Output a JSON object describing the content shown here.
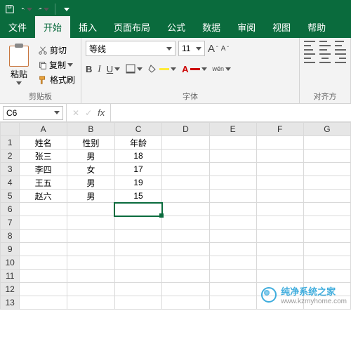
{
  "titlebar": {
    "icons": [
      "save-icon",
      "undo-icon",
      "redo-icon"
    ]
  },
  "tabs": {
    "items": [
      "文件",
      "开始",
      "插入",
      "页面布局",
      "公式",
      "数据",
      "审阅",
      "视图",
      "帮助"
    ],
    "active_index": 1
  },
  "ribbon": {
    "clipboard": {
      "paste": "粘贴",
      "cut": "剪切",
      "copy": "复制",
      "format_painter": "格式刷",
      "group_label": "剪贴板"
    },
    "font": {
      "name": "等线",
      "size": "11",
      "bold": "B",
      "italic": "I",
      "underline": "U",
      "ruby": "wén",
      "group_label": "字体"
    },
    "alignment": {
      "group_label": "对齐方"
    }
  },
  "namebox": {
    "ref": "C6"
  },
  "columns": [
    "A",
    "B",
    "C",
    "D",
    "E",
    "F",
    "G"
  ],
  "rows": [
    {
      "n": "1",
      "cells": [
        "姓名",
        "性别",
        "年龄",
        "",
        "",
        "",
        ""
      ]
    },
    {
      "n": "2",
      "cells": [
        "张三",
        "男",
        "18",
        "",
        "",
        "",
        ""
      ]
    },
    {
      "n": "3",
      "cells": [
        "李四",
        "女",
        "17",
        "",
        "",
        "",
        ""
      ]
    },
    {
      "n": "4",
      "cells": [
        "王五",
        "男",
        "19",
        "",
        "",
        "",
        ""
      ]
    },
    {
      "n": "5",
      "cells": [
        "赵六",
        "男",
        "15",
        "",
        "",
        "",
        ""
      ]
    },
    {
      "n": "6",
      "cells": [
        "",
        "",
        "",
        "",
        "",
        "",
        ""
      ]
    },
    {
      "n": "7",
      "cells": [
        "",
        "",
        "",
        "",
        "",
        "",
        ""
      ]
    },
    {
      "n": "8",
      "cells": [
        "",
        "",
        "",
        "",
        "",
        "",
        ""
      ]
    },
    {
      "n": "9",
      "cells": [
        "",
        "",
        "",
        "",
        "",
        "",
        ""
      ]
    },
    {
      "n": "10",
      "cells": [
        "",
        "",
        "",
        "",
        "",
        "",
        ""
      ]
    },
    {
      "n": "11",
      "cells": [
        "",
        "",
        "",
        "",
        "",
        "",
        ""
      ]
    },
    {
      "n": "12",
      "cells": [
        "",
        "",
        "",
        "",
        "",
        "",
        ""
      ]
    },
    {
      "n": "13",
      "cells": [
        "",
        "",
        "",
        "",
        "",
        "",
        ""
      ]
    }
  ],
  "active_cell": {
    "row": 6,
    "col": 3
  },
  "watermark": {
    "line1": "纯净系统之家",
    "line2": "www.kzmyhome.com"
  }
}
